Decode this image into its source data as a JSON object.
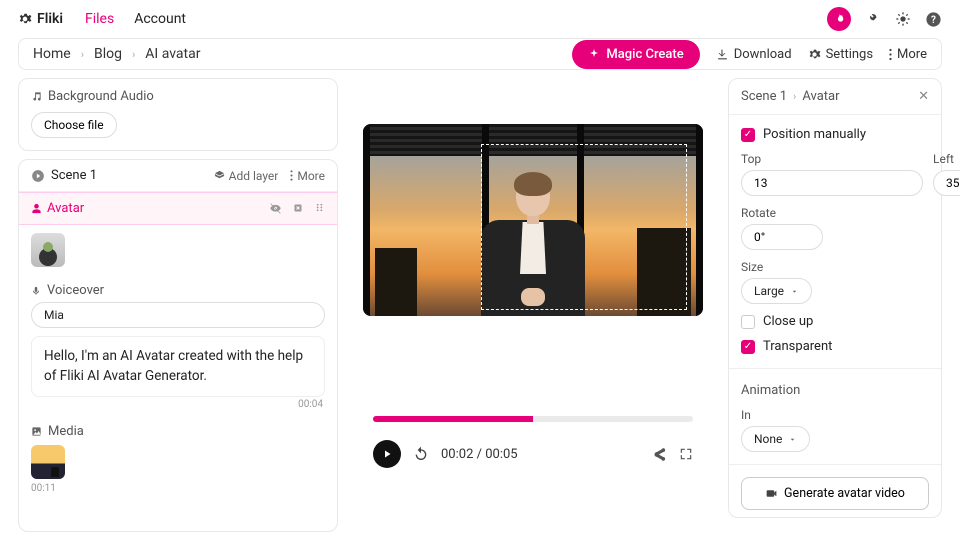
{
  "brand": "Fliki",
  "tabs": {
    "files": "Files",
    "account": "Account"
  },
  "breadcrumb": [
    "Home",
    "Blog",
    "AI avatar"
  ],
  "subbar": {
    "magic": "Magic Create",
    "download": "Download",
    "settings": "Settings",
    "more": "More"
  },
  "audio": {
    "label": "Background Audio",
    "choose": "Choose file"
  },
  "scene": {
    "title": "Scene 1",
    "add_layer": "Add layer",
    "more": "More",
    "avatar_label": "Avatar",
    "voiceover_label": "Voiceover",
    "voice_chip": "Mia",
    "transcript": "Hello, I'm an AI Avatar created with the help of Fliki AI Avatar Generator.",
    "duration": "00:04",
    "media_label": "Media",
    "media_time": "00:11"
  },
  "player": {
    "current": "00:02",
    "total": "00:05",
    "progress_pct": 50
  },
  "panel": {
    "crumb1": "Scene 1",
    "crumb2": "Avatar",
    "position_manually": "Position manually",
    "top_label": "Top",
    "top_val": "13",
    "left_label": "Left",
    "left_val": "35",
    "rotate_label": "Rotate",
    "rotate_val": "0°",
    "size_label": "Size",
    "size_val": "Large",
    "closeup": "Close up",
    "transparent": "Transparent",
    "animation_label": "Animation",
    "in_label": "In",
    "in_val": "None",
    "generate": "Generate avatar video"
  }
}
